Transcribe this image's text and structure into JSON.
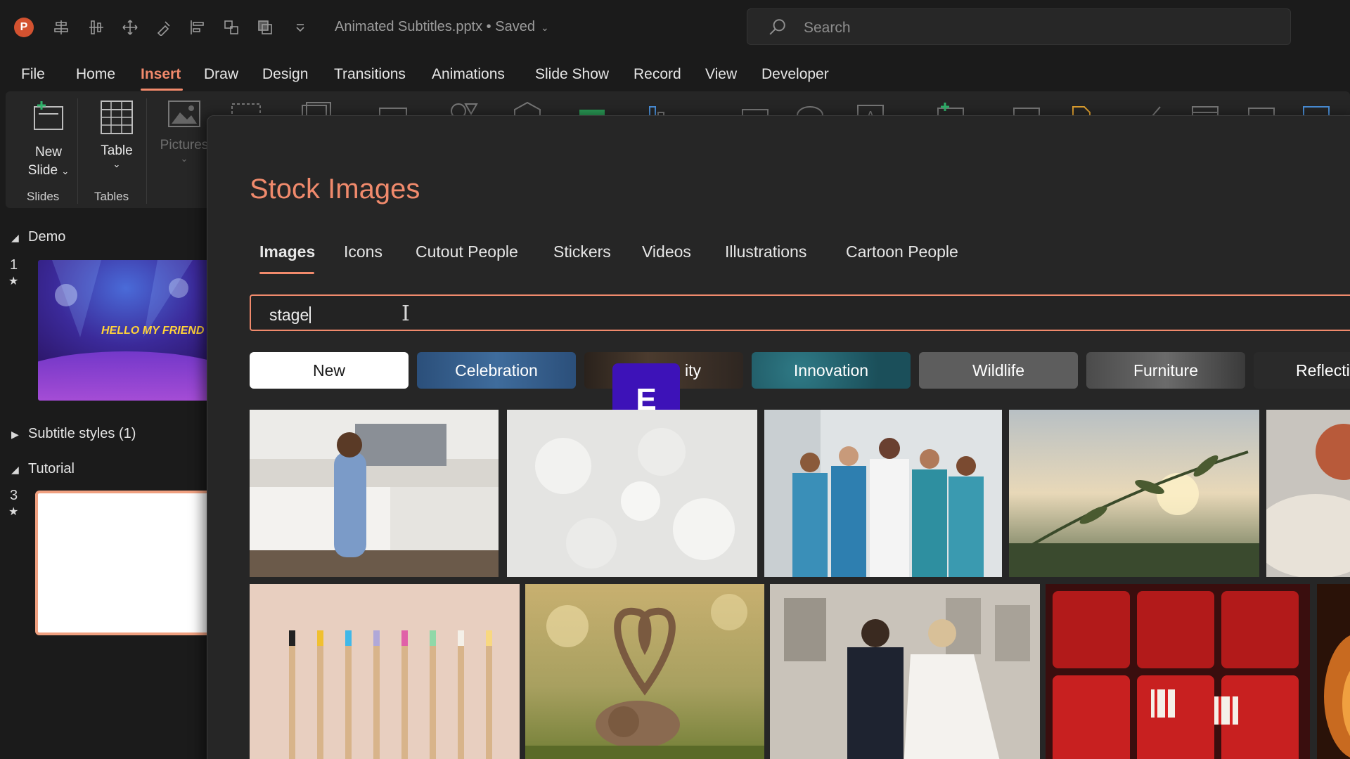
{
  "app": {
    "logo_letter": "P",
    "doc_title": "Animated Subtitles.pptx • Saved",
    "search_placeholder": "Search"
  },
  "menu": {
    "tabs": [
      {
        "label": "File"
      },
      {
        "label": "Home"
      },
      {
        "label": "Insert",
        "active": true
      },
      {
        "label": "Draw"
      },
      {
        "label": "Design"
      },
      {
        "label": "Transitions"
      },
      {
        "label": "Animations"
      },
      {
        "label": "Slide Show"
      },
      {
        "label": "Record"
      },
      {
        "label": "View"
      },
      {
        "label": "Developer"
      }
    ]
  },
  "ribbon": {
    "new_slide_line1": "New",
    "new_slide_line2": "Slide",
    "table_label": "Table",
    "pictures_label": "Pictures",
    "group_slides": "Slides",
    "group_tables": "Tables"
  },
  "slides_panel": {
    "sections": [
      {
        "name": "Demo",
        "expanded": true
      },
      {
        "name": "Subtitle styles (1)",
        "expanded": false
      },
      {
        "name": "Tutorial",
        "expanded": true
      }
    ],
    "slides": [
      {
        "number": "1",
        "thumb_text": "HELLO MY FRIEND"
      },
      {
        "number": "3"
      }
    ]
  },
  "dialog": {
    "title": "Stock Images",
    "tabs": [
      {
        "label": "Images",
        "active": true
      },
      {
        "label": "Icons"
      },
      {
        "label": "Cutout People"
      },
      {
        "label": "Stickers"
      },
      {
        "label": "Videos"
      },
      {
        "label": "Illustrations"
      },
      {
        "label": "Cartoon People"
      }
    ],
    "search_value": "stage",
    "chips": [
      "New",
      "Celebration",
      "ity",
      "Innovation",
      "Wildlife",
      "Furniture",
      "Reflecti"
    ],
    "badge_letter": "E"
  },
  "colors": {
    "accent": "#f28a6c",
    "badge": "#3d12b8",
    "app_background": "#1b1b1b",
    "dialog_background": "#262626"
  }
}
